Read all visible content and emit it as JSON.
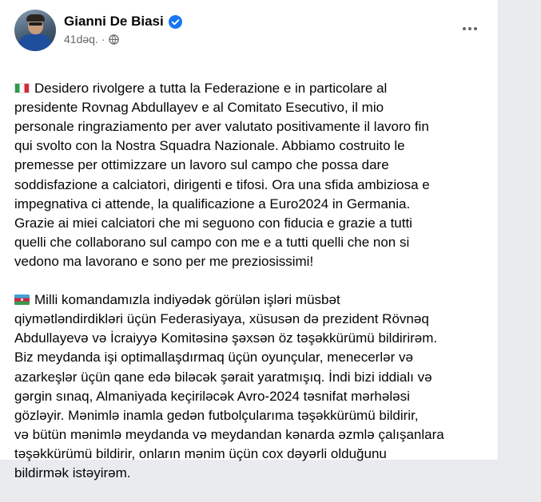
{
  "post": {
    "author": "Gianni De Biasi",
    "time": "41dəq.",
    "separator": "·",
    "paragraph_it": "Desidero rivolgere a tutta la Federazione e in particolare al\npresidente Rovnag Abdullayev e al Comitato Esecutivo, il mio\npersonale ringraziamento per aver valutato positivamente il lavoro fin\nqui svolto con la Nostra Squadra Nazionale. Abbiamo costruito le\npremesse per ottimizzare un lavoro sul campo che possa dare\nsoddisfazione a calciatori, dirigenti e tifosi. Ora una sfida ambiziosa e\nimpegnativa ci attende, la qualificazione a Euro2024 in Germania.\nGrazie ai miei calciatori che mi seguono con fiducia e grazie a tutti\nquelli che collaborano sul campo con me e a tutti quelli che non si\nvedono ma lavorano e sono per me preziosissimi!",
    "paragraph_az": "Milli komandamızla indiyədək görülən işləri müsbət\nqiymətləndirdikləri üçün Federasiyaya, xüsusən də prezident Rövnəq\nAbdullayevə və İcraiyyə Komitəsinə şəxsən öz təşəkkürümü bildirirəm.\nBiz meydanda işi optimallaşdırmaq üçün oyunçular, menecerlər və\nazarkeşlər üçün qane edə biləcək şərait yaratmışıq.  İndi bizi iddialı və\ngərgin sınaq, Almaniyada keçiriləcək Avro-2024 təsnifat mərhələsi\ngözləyir. Mənimlə inamla gedən futbolçularıma təşəkkürümü bildirir,\nvə bütün mənimlə meydanda və meydandan kənarda əzmlə çalışanlara\ntəşəkkürümü bildirir, onların mənim üçün cox dəyərli olduğunu\nbildirmək istəyirəm."
  },
  "icons": {
    "verified": "verified-badge-icon",
    "privacy": "globe-icon",
    "more": "more-options-icon",
    "flag_it": "italy-flag-icon",
    "flag_az": "azerbaijan-flag-icon"
  },
  "colors": {
    "verified_blue": "#1877f2",
    "secondary_text": "#65676b"
  }
}
